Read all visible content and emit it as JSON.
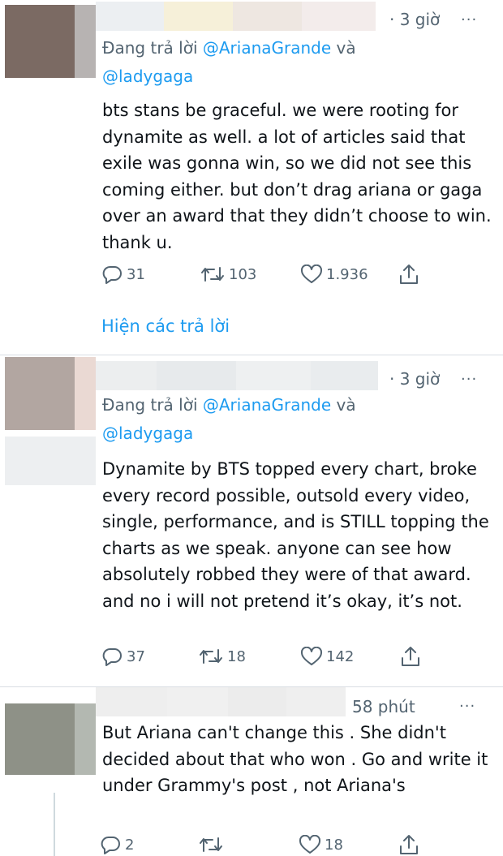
{
  "tweets": [
    {
      "time": "· 3 giờ",
      "more": "···",
      "reply_prefix": "Đang trả lời",
      "mention1": "@ArianaGrande",
      "conj": "và",
      "mention2": "@ladygaga",
      "text": "bts stans be graceful. we were rooting for dynamite as well. a lot of articles said that exile was gonna win, so we did not see this coming either. but don’t drag ariana or gaga over an award that they didn’t choose to win. thank u.",
      "replies": "31",
      "retweets": "103",
      "likes": "1.936",
      "show_replies": "Hiện các trả lời"
    },
    {
      "time": "· 3 giờ",
      "more": "···",
      "reply_prefix": "Đang trả lời",
      "mention1": "@ArianaGrande",
      "conj": "và",
      "mention2": "@ladygaga",
      "text": "Dynamite by BTS topped every chart, broke every record possible, outsold every video, single, performance, and is STILL topping the charts as we speak. anyone can see how absolutely robbed they were of that award. and no i will not pretend it’s okay, it’s not.",
      "replies": "37",
      "retweets": "18",
      "likes": "142"
    },
    {
      "time": "58 phút",
      "more": "···",
      "text": "But Ariana can't change this . She didn't decided about that who won . Go and write it under Grammy's post , not Ariana's",
      "replies": "2",
      "likes": "18"
    }
  ],
  "colors": {
    "accent": "#1d9bf0",
    "muted": "#536471",
    "text": "#0f1419",
    "divider": "#d9dee3"
  },
  "icons": [
    "reply-icon",
    "retweet-icon",
    "like-icon",
    "share-icon",
    "more-icon"
  ]
}
